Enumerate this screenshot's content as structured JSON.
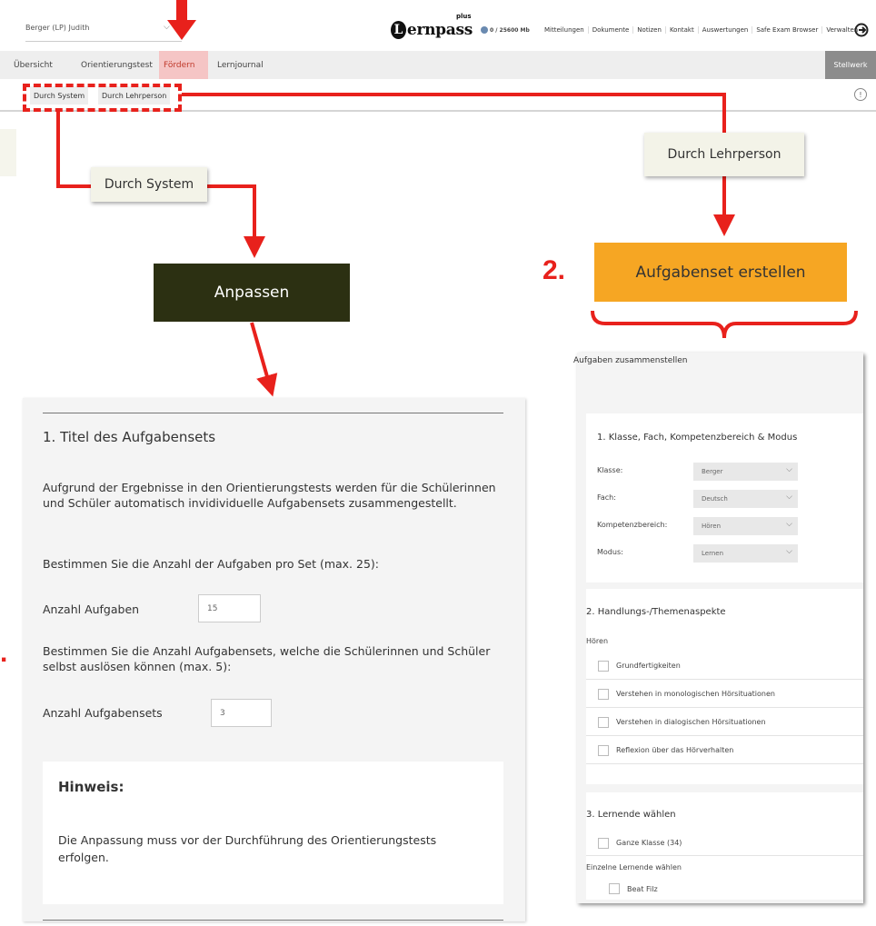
{
  "topbar": {
    "user_select": "Berger (LP) Judith",
    "logo_letter": "L",
    "logo_text": "ernpass",
    "logo_plus": "plus",
    "storage": "0 / 25600 Mb",
    "nav": [
      "Mitteilungen",
      "Dokumente",
      "Notizen",
      "Kontakt",
      "Auswertungen",
      "Safe Exam Browser",
      "Verwalten"
    ]
  },
  "tabs": [
    "Übersicht",
    "Orientierungstest",
    "Fördern",
    "Lernjournal"
  ],
  "active_tab": "Fördern",
  "stellwerk": "Stellwerk",
  "subtabs": [
    "Durch System",
    "Durch Lehrperson"
  ],
  "labels": {
    "durch_system": "Durch System",
    "durch_lehrperson": "Durch Lehrperson",
    "anpassen": "Anpassen",
    "aufgabenset": "Aufgabenset erstellen",
    "num2": "2.",
    "num1": "."
  },
  "left_panel": {
    "title": "1. Titel des Aufgabensets",
    "intro": "Aufgrund der Ergebnisse in den Orientierungstests werden für die Schülerinnen und Schüler automatisch invidividuelle Aufgabensets zusammengestellt.",
    "bestimmen1": "Bestimmen Sie die Anzahl der Aufgaben pro Set (max. 25):",
    "anzahl_aufgaben_label": "Anzahl Aufgaben",
    "anzahl_aufgaben_value": "15",
    "bestimmen2": "Bestimmen Sie die Anzahl Aufgabensets, welche die Schülerinnen und Schüler selbst auslösen können (max. 5):",
    "anzahl_sets_label": "Anzahl Aufgabensets",
    "anzahl_sets_value": "3",
    "hinweis_title": "Hinweis:",
    "hinweis_text": "Die Anpassung muss vor der Durchführung des Orientierungstests erfolgen."
  },
  "right_panel": {
    "header": "Aufgaben zusammenstellen",
    "section1_title": "1. Klasse, Fach, Kompetenzbereich & Modus",
    "fields": [
      {
        "label": "Klasse:",
        "value": "Berger"
      },
      {
        "label": "Fach:",
        "value": "Deutsch"
      },
      {
        "label": "Kompetenzbereich:",
        "value": "Hören"
      },
      {
        "label": "Modus:",
        "value": "Lernen"
      }
    ],
    "section2_title": "2. Handlungs-/Themenaspekte",
    "section2_sub": "Hören",
    "aspects": [
      "Grundfertigkeiten",
      "Verstehen in monologischen Hörsituationen",
      "Verstehen in dialogischen Hörsituationen",
      "Reflexion über das Hörverhalten"
    ],
    "section3_title": "3. Lernende wählen",
    "ganze_klasse": "Ganze Klasse (34)",
    "einzelne": "Einzelne Lernende wählen",
    "student": "Beat Filz"
  },
  "colors": {
    "accent_red": "#e8211c",
    "anpassen_bg": "#2c3012",
    "aufgabenset_bg": "#f6a623",
    "active_tab_bg": "#f5c5c5"
  }
}
